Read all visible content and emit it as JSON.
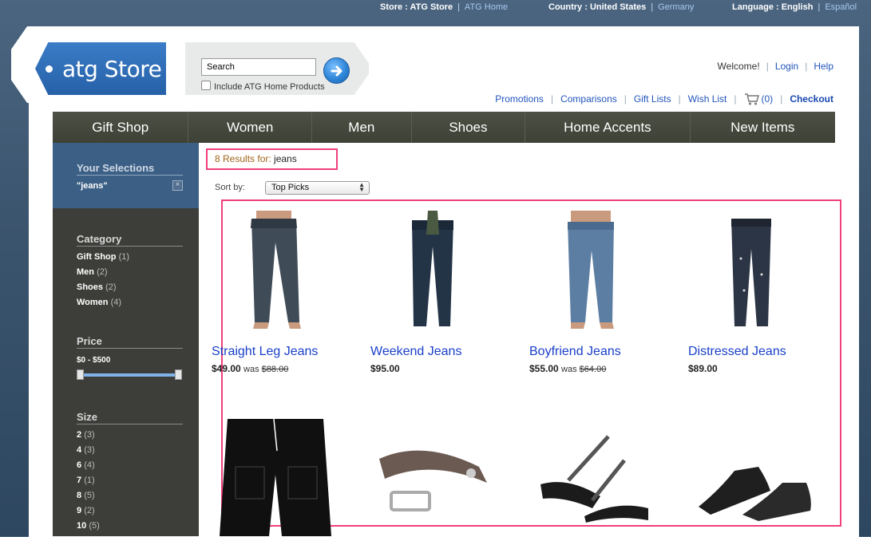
{
  "topbar": {
    "store_label": "Store : ATG Store",
    "store_alt_link": "ATG Home",
    "country_label": "Country : United States",
    "country_alt_link": "Germany",
    "language_label": "Language : English",
    "language_alt_link": "Español"
  },
  "logo": {
    "text": "atg Store"
  },
  "search": {
    "value": "Search",
    "include_label": "Include ATG Home Products"
  },
  "account": {
    "welcome": "Welcome!",
    "login": "Login",
    "help": "Help"
  },
  "util_links": {
    "promotions": "Promotions",
    "comparisons": "Comparisons",
    "gift_lists": "Gift Lists",
    "wish_list": "Wish List",
    "cart_count": "(0)",
    "checkout": "Checkout"
  },
  "nav": {
    "items": [
      "Gift Shop",
      "Women",
      "Men",
      "Shoes",
      "Home Accents",
      "New Items"
    ]
  },
  "sidebar": {
    "selections_heading": "Your Selections",
    "selection_term": "\"jeans\"",
    "remove_icon": "close-icon",
    "category_heading": "Category",
    "categories": [
      {
        "label": "Gift Shop",
        "count": "(1)"
      },
      {
        "label": "Men",
        "count": "(2)"
      },
      {
        "label": "Shoes",
        "count": "(2)"
      },
      {
        "label": "Women",
        "count": "(4)"
      }
    ],
    "price_heading": "Price",
    "price_range": "$0 - $500",
    "size_heading": "Size",
    "sizes": [
      {
        "label": "2",
        "count": "(3)"
      },
      {
        "label": "4",
        "count": "(3)"
      },
      {
        "label": "6",
        "count": "(4)"
      },
      {
        "label": "7",
        "count": "(1)"
      },
      {
        "label": "8",
        "count": "(5)"
      },
      {
        "label": "9",
        "count": "(2)"
      },
      {
        "label": "10",
        "count": "(5)"
      }
    ]
  },
  "results": {
    "count_text": "8 Results for:",
    "term": "jeans",
    "sort_label": "Sort by:",
    "sort_value": "Top Picks"
  },
  "products": [
    {
      "name": "Straight Leg Jeans",
      "price": "$49.00",
      "was_label": "was",
      "old_price": "$88.00",
      "icon": "jeans-image"
    },
    {
      "name": "Weekend Jeans",
      "price": "$95.00",
      "icon": "jeans-image"
    },
    {
      "name": "Boyfriend Jeans",
      "price": "$55.00",
      "was_label": "was",
      "old_price": "$64.00",
      "icon": "jeans-image"
    },
    {
      "name": "Distressed Jeans",
      "price": "$89.00",
      "icon": "jeans-image"
    },
    {
      "icon": "shorts-image"
    },
    {
      "icon": "belt-image"
    },
    {
      "icon": "sandals-image"
    },
    {
      "icon": "dress-shoes-image"
    }
  ],
  "colors": {
    "accent_blue": "#2255bb",
    "highlight_pink": "#f0407a",
    "nav_bg": "#44473c",
    "sidebar_bg": "#3d3d3a"
  }
}
